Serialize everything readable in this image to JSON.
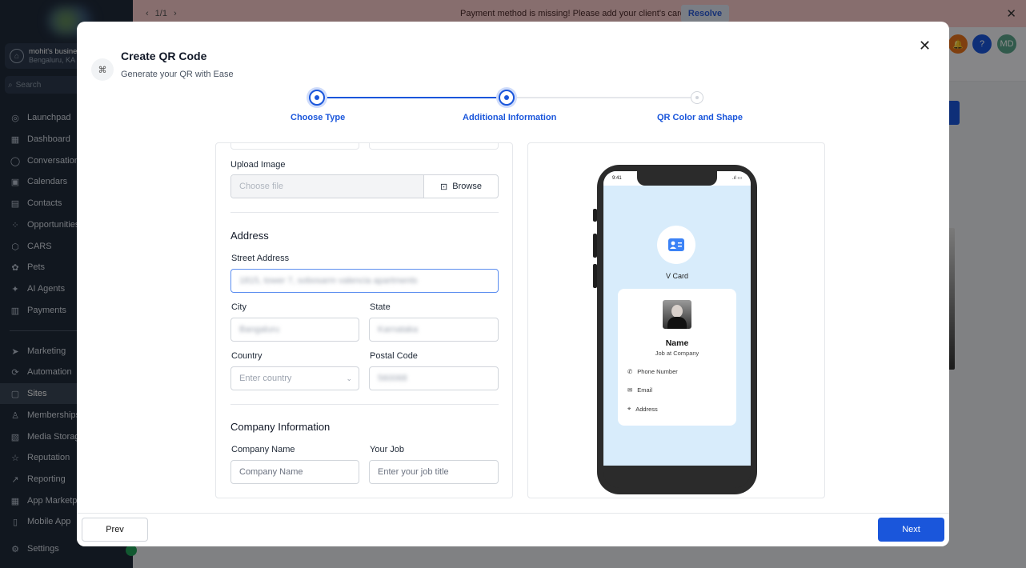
{
  "banner": {
    "pager": "1/1",
    "message": "Payment method is missing! Please add your client's card.",
    "resolve": "Resolve"
  },
  "account": {
    "name": "mohit's busines",
    "location": "Bengaluru, KA"
  },
  "sidebar": {
    "search_placeholder": "Search",
    "items": [
      {
        "label": "Launchpad",
        "icon": "rocket-icon"
      },
      {
        "label": "Dashboard",
        "icon": "grid-icon"
      },
      {
        "label": "Conversations",
        "icon": "chat-icon"
      },
      {
        "label": "Calendars",
        "icon": "calendar-icon"
      },
      {
        "label": "Contacts",
        "icon": "contacts-icon"
      },
      {
        "label": "Opportunities",
        "icon": "opportunities-icon"
      },
      {
        "label": "CARS",
        "icon": "box-icon"
      },
      {
        "label": "Pets",
        "icon": "paw-icon"
      },
      {
        "label": "AI Agents",
        "icon": "sparkle-icon"
      },
      {
        "label": "Payments",
        "icon": "receipt-icon"
      },
      {
        "label": "Marketing",
        "icon": "send-icon"
      },
      {
        "label": "Automation",
        "icon": "automation-icon"
      },
      {
        "label": "Sites",
        "icon": "sites-icon"
      },
      {
        "label": "Memberships",
        "icon": "membership-icon"
      },
      {
        "label": "Media Storage",
        "icon": "image-icon"
      },
      {
        "label": "Reputation",
        "icon": "star-icon"
      },
      {
        "label": "Reporting",
        "icon": "trend-icon"
      },
      {
        "label": "App Marketplace",
        "icon": "apps-icon"
      },
      {
        "label": "Mobile App",
        "icon": "mobile-icon"
      },
      {
        "label": "Settings",
        "icon": "gear-icon"
      }
    ]
  },
  "header": {
    "help": "?",
    "avatar": "MD"
  },
  "modal": {
    "title": "Create QR Code",
    "subtitle": "Generate your QR with Ease",
    "steps": [
      "Choose Type",
      "Additional Information",
      "QR Color and Shape"
    ],
    "prev": "Prev",
    "next": "Next"
  },
  "form": {
    "upload_label": "Upload Image",
    "upload_placeholder": "Choose file",
    "browse": "Browse",
    "address_heading": "Address",
    "street_label": "Street Address",
    "street_value": "1815, tower 7, sobosarm valencia apartments",
    "city_label": "City",
    "city_value": "Bangaluru",
    "state_label": "State",
    "state_value": "Karnataka",
    "country_label": "Country",
    "country_placeholder": "Enter country",
    "postal_label": "Postal Code",
    "postal_value": "560068",
    "company_heading": "Company Information",
    "company_label": "Company Name",
    "company_placeholder": "Company Name",
    "job_label": "Your Job",
    "job_placeholder": "Enter your job title"
  },
  "preview": {
    "time": "9:41",
    "vcard_label": "V Card",
    "name": "Name",
    "job": "Job at Company",
    "phone": "Phone Number",
    "email": "Email",
    "address": "Address"
  }
}
